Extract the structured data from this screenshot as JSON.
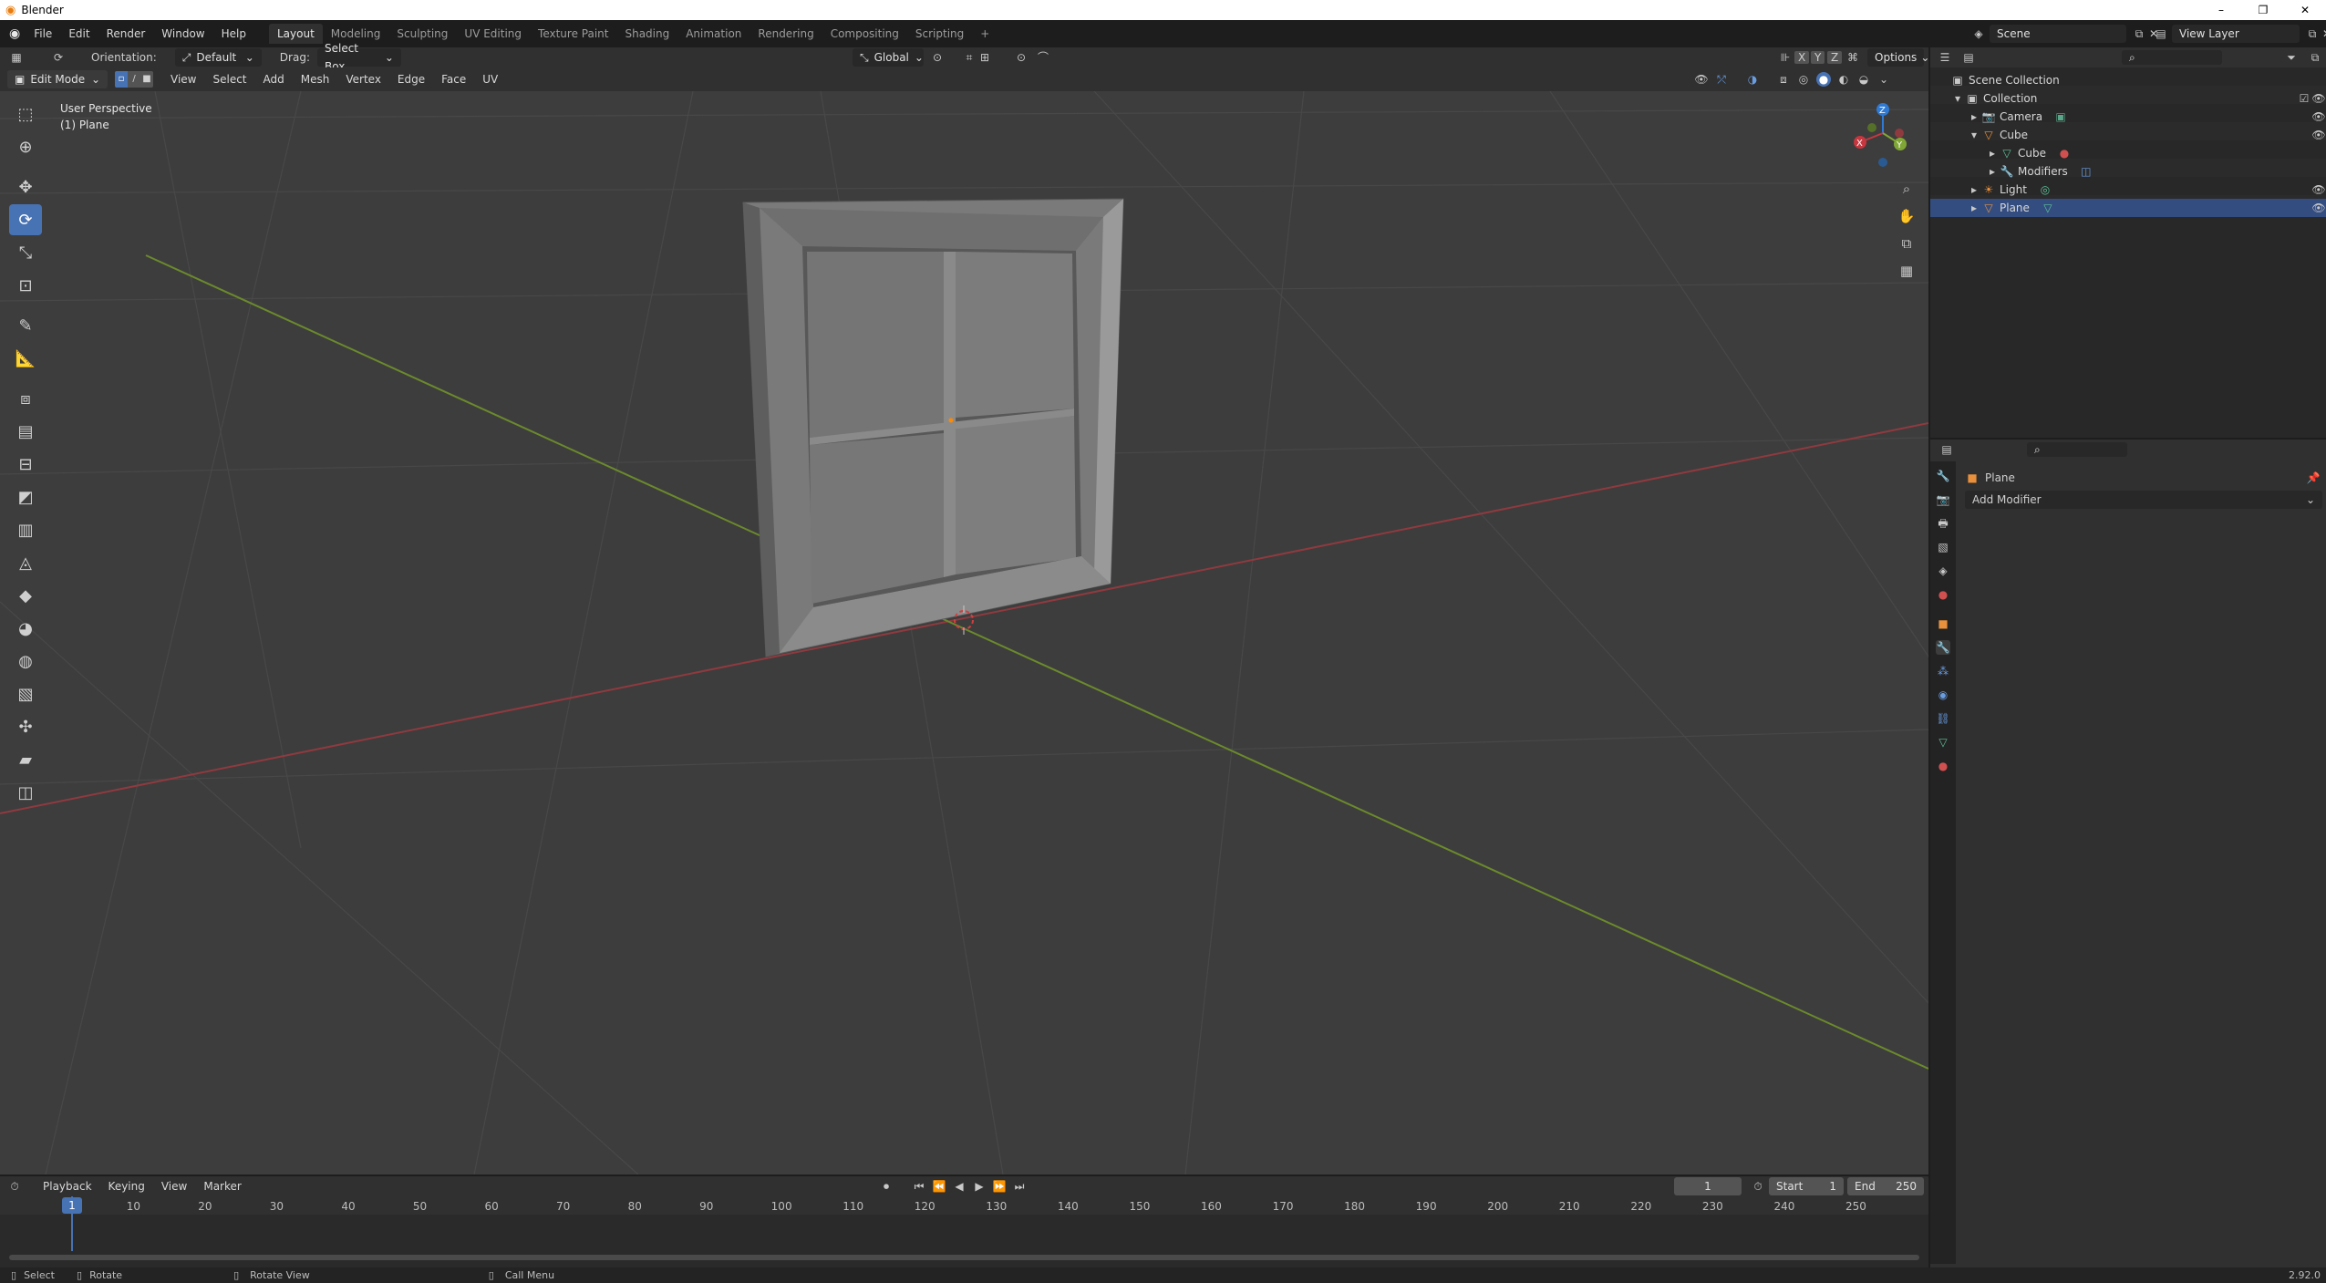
{
  "window": {
    "title": "Blender",
    "min": "–",
    "max": "❐",
    "close": "✕"
  },
  "menus": [
    "File",
    "Edit",
    "Render",
    "Window",
    "Help"
  ],
  "workspaces": [
    "Layout",
    "Modeling",
    "Sculpting",
    "UV Editing",
    "Texture Paint",
    "Shading",
    "Animation",
    "Rendering",
    "Compositing",
    "Scripting",
    "+"
  ],
  "scene": {
    "name": "Scene",
    "view_layer": "View Layer"
  },
  "toolheader": {
    "orientation_label": "Orientation:",
    "orientation_value": "Default",
    "drag_label": "Drag:",
    "drag_value": "Select Box",
    "transform_orientation": "Global",
    "axes": [
      "X",
      "Y",
      "Z"
    ],
    "options": "Options"
  },
  "viewport_header": {
    "mode": "Edit Mode",
    "menus": [
      "View",
      "Select",
      "Add",
      "Mesh",
      "Vertex",
      "Edge",
      "Face",
      "UV"
    ]
  },
  "viewport": {
    "perspective": "User Perspective",
    "object": "(1) Plane"
  },
  "gizmo": {
    "z": "Z",
    "x": "X",
    "y": "Y"
  },
  "outliner": {
    "root": "Scene Collection",
    "items": [
      {
        "label": "Collection"
      },
      {
        "label": "Camera"
      },
      {
        "label": "Cube"
      },
      {
        "label": "Cube"
      },
      {
        "label": "Modifiers"
      },
      {
        "label": "Light"
      },
      {
        "label": "Plane"
      }
    ]
  },
  "properties": {
    "object": "Plane",
    "add_modifier": "Add Modifier"
  },
  "timeline": {
    "menus": [
      "Playback",
      "Keying",
      "View",
      "Marker"
    ],
    "current_frame": "1",
    "start_label": "Start",
    "start": "1",
    "end_label": "End",
    "end": "250",
    "ticks": [
      "1",
      "10",
      "20",
      "30",
      "40",
      "50",
      "60",
      "70",
      "80",
      "90",
      "100",
      "110",
      "120",
      "130",
      "140",
      "150",
      "160",
      "170",
      "180",
      "190",
      "200",
      "210",
      "220",
      "230",
      "240",
      "250"
    ]
  },
  "statusbar": {
    "select": "Select",
    "rotate": "Rotate",
    "rotate_view": "Rotate View",
    "call_menu": "Call Menu",
    "version": "2.92.0"
  },
  "colors": {
    "accent": "#4772b3",
    "x_axis": "#c6373f",
    "y_axis": "#80a636",
    "z_axis": "#2f7ad4",
    "viewport_bg": "#3d3d3d"
  }
}
